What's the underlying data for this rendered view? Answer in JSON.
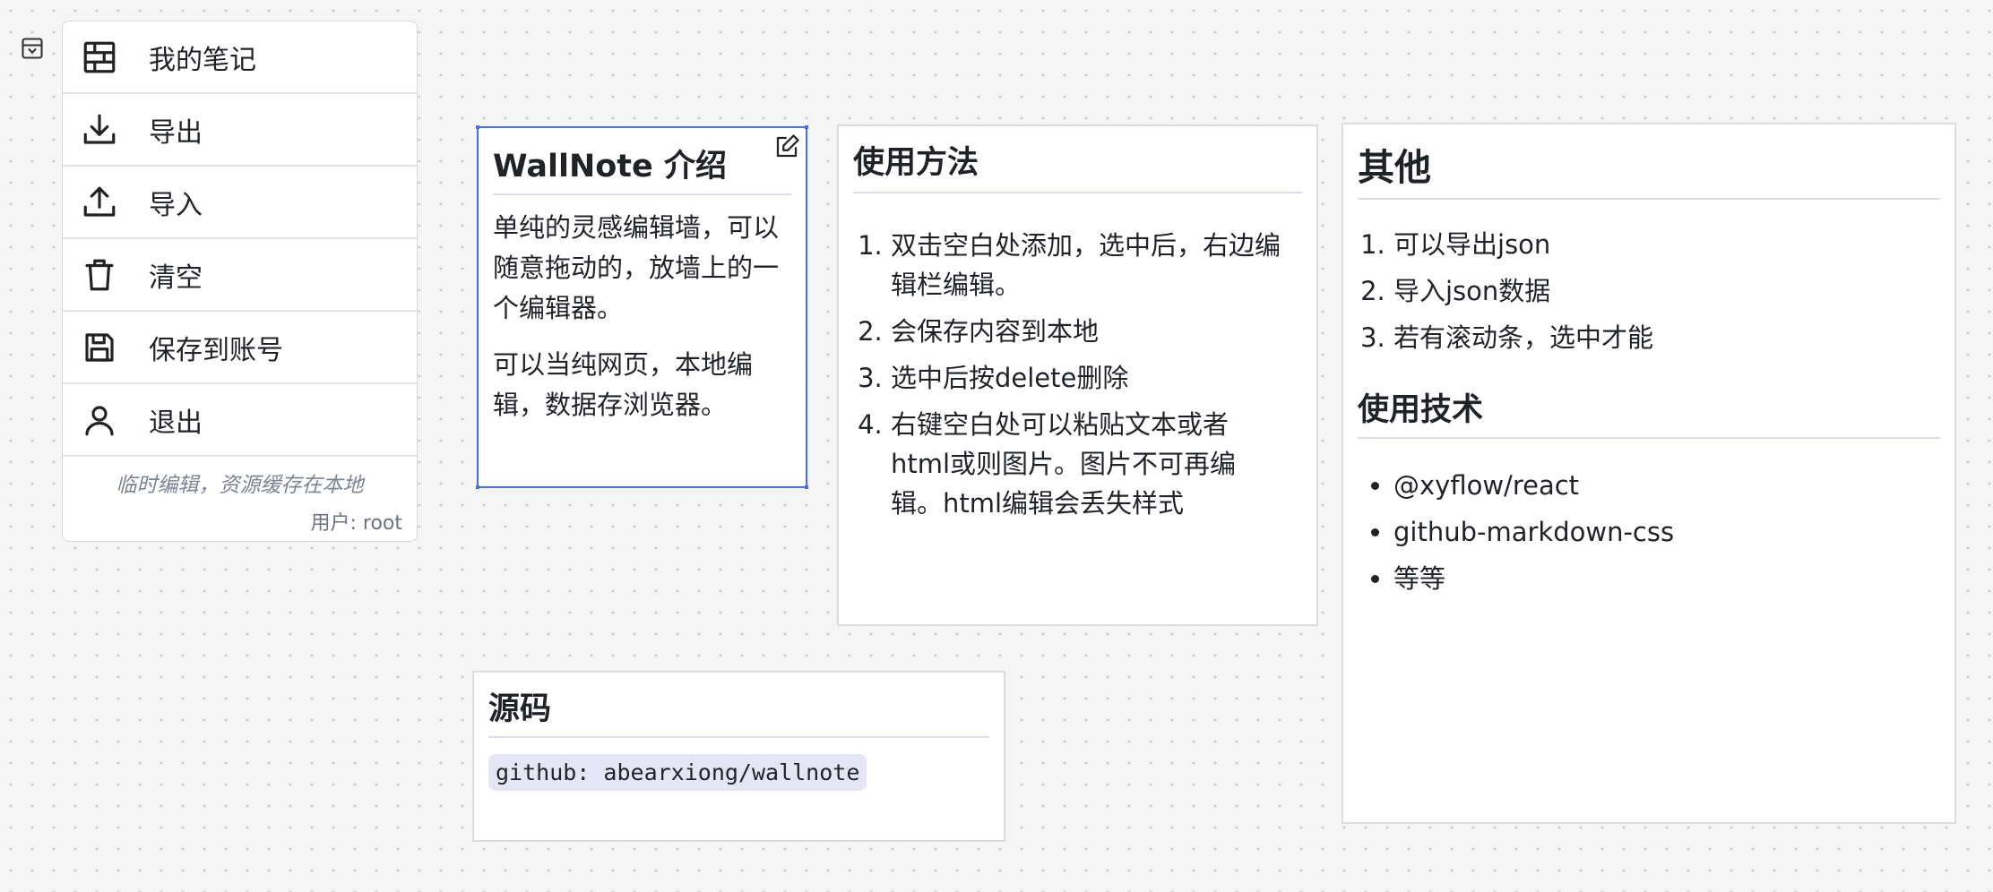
{
  "menu": {
    "items": [
      {
        "label": "我的笔记",
        "icon": "grid-wall-icon"
      },
      {
        "label": "导出",
        "icon": "download-icon"
      },
      {
        "label": "导入",
        "icon": "upload-icon"
      },
      {
        "label": "清空",
        "icon": "trash-icon"
      },
      {
        "label": "保存到账号",
        "icon": "save-icon"
      },
      {
        "label": "退出",
        "icon": "user-icon"
      }
    ],
    "note": "临时编辑，资源缓存在本地",
    "user": "用户: root"
  },
  "cards": {
    "intro": {
      "title": "WallNote 介绍",
      "para1": "单纯的灵感编辑墙，可以随意拖动的，放墙上的一个编辑器。",
      "para2": "可以当纯网页，本地编辑，数据存浏览器。"
    },
    "usage": {
      "title": "使用方法",
      "items": [
        "双击空白处添加，选中后，右边编辑栏编辑。",
        "会保存内容到本地",
        "选中后按delete删除",
        "右键空白处可以粘贴文本或者html或则图片。图片不可再编辑。html编辑会丢失样式"
      ]
    },
    "other": {
      "title": "其他",
      "items": [
        "可以导出json",
        "导入json数据",
        "若有滚动条，选中才能"
      ],
      "tech_title": "使用技术",
      "tech_items": [
        "@xyflow/react",
        "github-markdown-css",
        "等等"
      ]
    },
    "source": {
      "title": "源码",
      "code": "github: abearxiong/wallnote"
    }
  },
  "colors": {
    "selection": "#4a6ee0",
    "canvas": "#f5f5f5",
    "code_bg": "#e4e6f5"
  }
}
